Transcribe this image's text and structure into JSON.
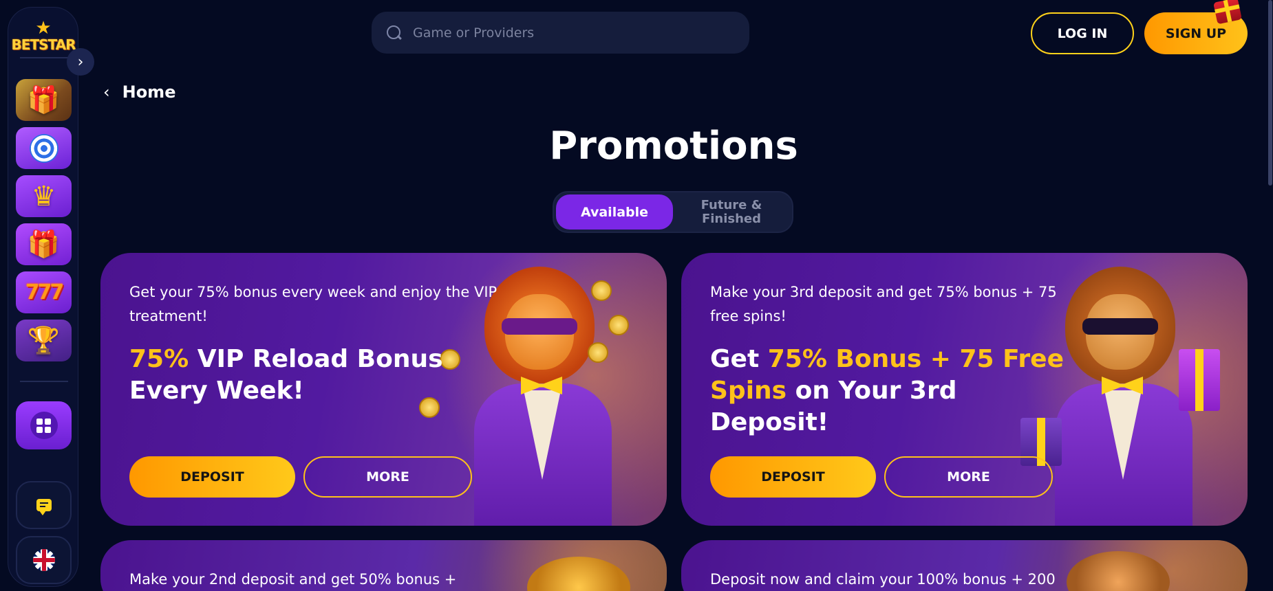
{
  "brand": {
    "logo_text": "BETSTAR"
  },
  "sidebar": {
    "tiles": [
      {
        "name": "gift-box",
        "icon": "gift-icon"
      },
      {
        "name": "target",
        "icon": "target-icon"
      },
      {
        "name": "crown",
        "icon": "crown-icon"
      },
      {
        "name": "present",
        "icon": "present-icon"
      },
      {
        "name": "slots-777",
        "icon": "slots-777-icon",
        "label": "777"
      },
      {
        "name": "trophy",
        "icon": "trophy-icon"
      }
    ],
    "apps_icon": "grid-icon",
    "chat_icon": "chat-icon",
    "language_icon": "uk-flag-icon"
  },
  "header": {
    "search_placeholder": "Game or Providers",
    "login_label": "LOG IN",
    "signup_label": "SIGN UP"
  },
  "breadcrumb": {
    "label": "Home"
  },
  "page": {
    "title": "Promotions"
  },
  "tabs": [
    {
      "label": "Available",
      "active": true
    },
    {
      "label": "Future &\nFinished",
      "active": false
    }
  ],
  "colors": {
    "background": "#040a22",
    "accent_yellow": "#ffc21a",
    "accent_purple": "#7b27e6"
  },
  "promos": [
    {
      "subtitle": "Get your 75% bonus every week and enjoy the VIP treatment!",
      "title_hl": "75%",
      "title_rest": " VIP Reload Bonus Every Week!",
      "deposit_label": "DEPOSIT",
      "more_label": "MORE"
    },
    {
      "subtitle": "Make your 3rd deposit and get 75% bonus + 75 free spins!",
      "title_pre": "Get ",
      "title_hl": "75% Bonus + 75 Free Spins",
      "title_rest": " on Your 3rd Deposit!",
      "deposit_label": "DEPOSIT",
      "more_label": "MORE"
    },
    {
      "subtitle": "Make your 2nd deposit and get 50% bonus +"
    },
    {
      "subtitle": "Deposit now and claim your 100% bonus + 200"
    }
  ]
}
